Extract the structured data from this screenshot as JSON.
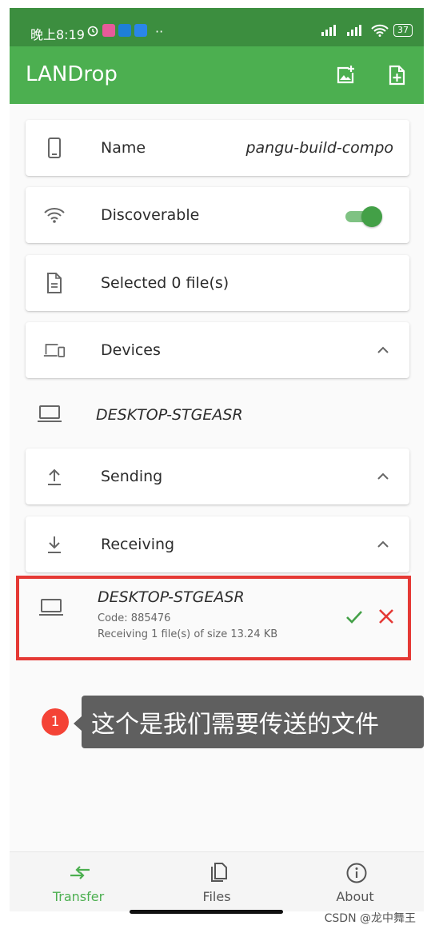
{
  "status_bar": {
    "time": "晚上8:19",
    "more": "··",
    "battery": "37"
  },
  "app_bar": {
    "title": "LANDrop"
  },
  "cards": {
    "name": {
      "label": "Name",
      "value": "pangu-build-compo"
    },
    "discoverable": {
      "label": "Discoverable",
      "enabled": true
    },
    "selected": {
      "label": "Selected 0 file(s)"
    },
    "devices": {
      "label": "Devices"
    },
    "sending": {
      "label": "Sending"
    },
    "receiving": {
      "label": "Receiving"
    }
  },
  "devices_list": [
    {
      "name": "DESKTOP-STGEASR"
    }
  ],
  "receiving_item": {
    "device": "DESKTOP-STGEASR",
    "code": "Code: 885476",
    "info": "Receiving 1 file(s) of size 13.24 KB"
  },
  "annotation": {
    "badge": "1",
    "text": "这个是我们需要传送的文件"
  },
  "bottom_nav": [
    {
      "label": "Transfer",
      "icon": "transfer-icon",
      "active": true
    },
    {
      "label": "Files",
      "icon": "files-icon",
      "active": false
    },
    {
      "label": "About",
      "icon": "info-icon",
      "active": false
    }
  ],
  "watermark": "CSDN @龙中舞王",
  "colors": {
    "primary": "#4caf50",
    "status_bar": "#3c8e3f",
    "accept": "#43a047",
    "reject": "#e53935",
    "highlight": "#e53935"
  }
}
